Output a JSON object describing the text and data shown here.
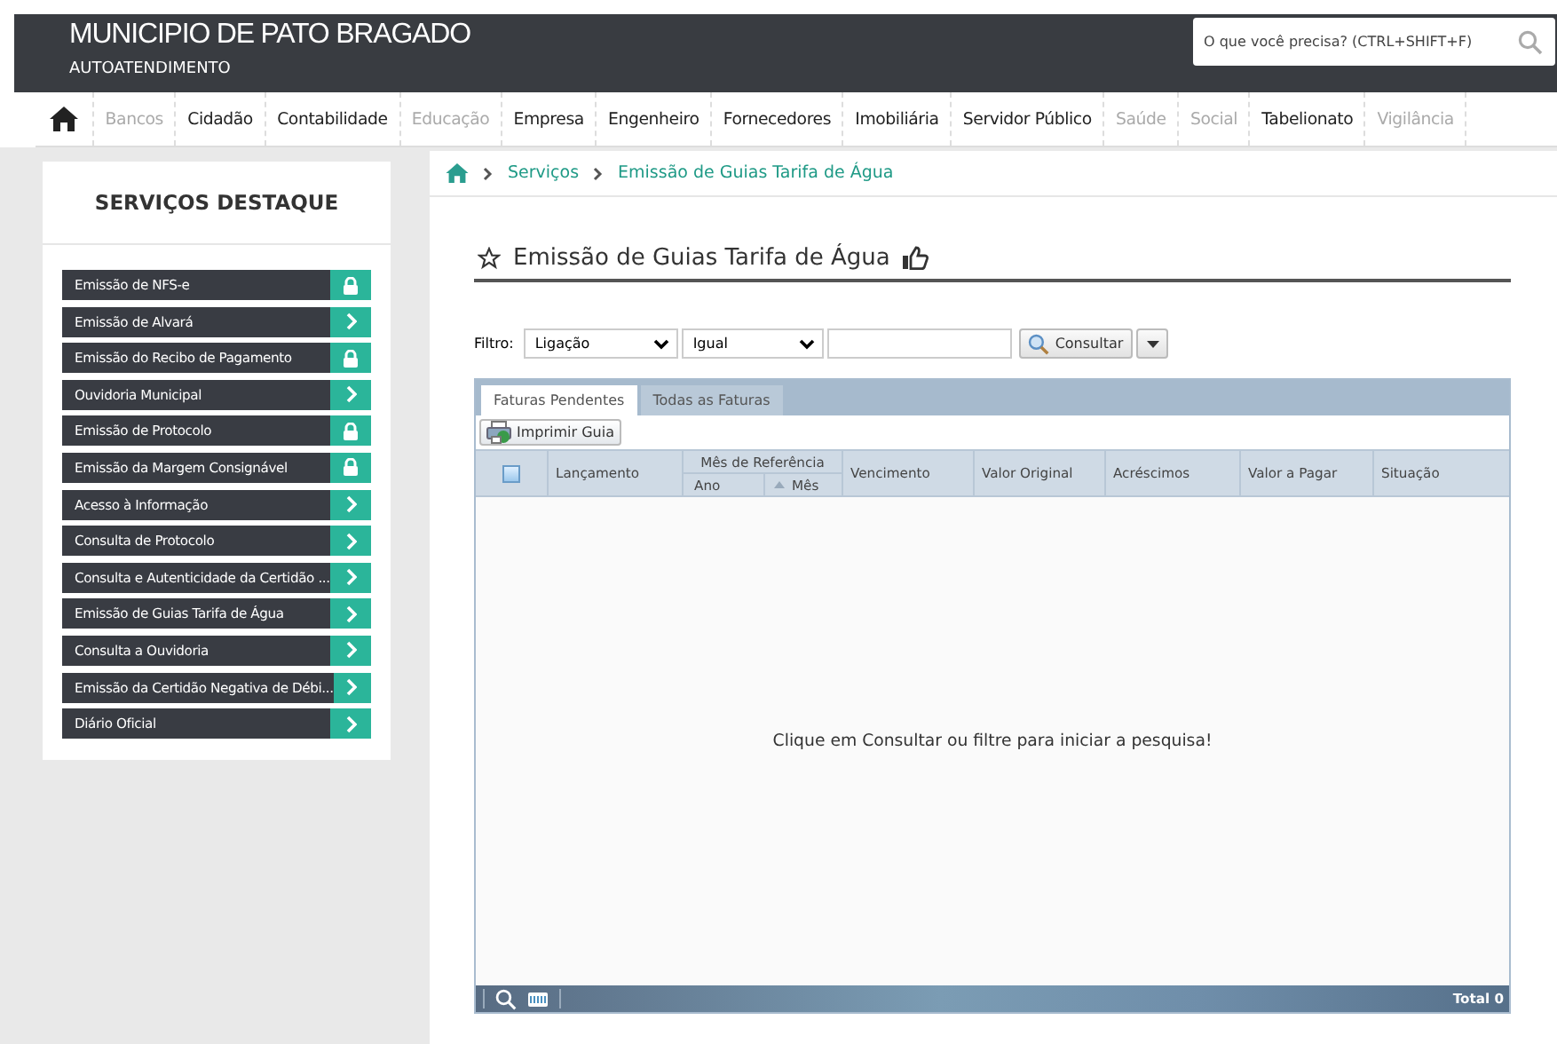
{
  "header": {
    "title": "MUNICIPIO DE PATO BRAGADO",
    "subtitle": "AUTOATENDIMENTO",
    "search": {
      "placeholder": "O que você precisa? (CTRL+SHIFT+F)"
    }
  },
  "nav": [
    {
      "label": "Bancos",
      "disabled": true
    },
    {
      "label": "Cidadão",
      "disabled": false
    },
    {
      "label": "Contabilidade",
      "disabled": false
    },
    {
      "label": "Educação",
      "disabled": true
    },
    {
      "label": "Empresa",
      "disabled": false
    },
    {
      "label": "Engenheiro",
      "disabled": false
    },
    {
      "label": "Fornecedores",
      "disabled": false
    },
    {
      "label": "Imobiliária",
      "disabled": false
    },
    {
      "label": "Servidor Público",
      "disabled": false
    },
    {
      "label": "Saúde",
      "disabled": true
    },
    {
      "label": "Social",
      "disabled": true
    },
    {
      "label": "Tabelionato",
      "disabled": false
    },
    {
      "label": "Vigilância",
      "disabled": true
    }
  ],
  "sidebar": {
    "title": "SERVIÇOS DESTAQUE",
    "items": [
      {
        "label": "Emissão de NFS-e",
        "kind": "lock"
      },
      {
        "label": "Emissão de Alvará",
        "kind": "arrow"
      },
      {
        "label": "Emissão do Recibo de Pagamento",
        "kind": "lock"
      },
      {
        "label": "Ouvidoria Municipal",
        "kind": "arrow"
      },
      {
        "label": "Emissão de Protocolo",
        "kind": "lock"
      },
      {
        "label": "Emissão da Margem Consignável",
        "kind": "lock"
      },
      {
        "label": "Acesso à Informação",
        "kind": "arrow"
      },
      {
        "label": "Consulta de Protocolo",
        "kind": "arrow"
      },
      {
        "label": "Consulta e Autenticidade da Certidão ...",
        "kind": "arrow"
      },
      {
        "label": "Emissão de Guias Tarifa de Água",
        "kind": "arrow"
      },
      {
        "label": "Consulta a Ouvidoria",
        "kind": "arrow"
      },
      {
        "label": "Emissão da Certidão Negativa de Débi...",
        "kind": "arrow"
      },
      {
        "label": "Diário Oficial",
        "kind": "arrow"
      }
    ]
  },
  "breadcrumb": [
    "Serviços",
    "Emissão de Guias Tarifa de Água"
  ],
  "page_title": "Emissão de Guias Tarifa de Água",
  "filter": {
    "label": "Filtro:",
    "field": "Ligação",
    "operator": "Igual",
    "button": "Consultar"
  },
  "tabs": [
    {
      "label": "Faturas Pendentes",
      "selected": true
    },
    {
      "label": "Todas as Faturas",
      "selected": false
    }
  ],
  "print_button": "Imprimir Guia",
  "columns": {
    "all_checked": false,
    "lancamento": "Lançamento",
    "group": "Mês de Referência",
    "ano": "Ano",
    "mes": "Mês",
    "rest": [
      "Vencimento",
      "Valor Original",
      "Acréscimos",
      "Valor a Pagar",
      "Situação"
    ]
  },
  "empty_message": "Clique em Consultar ou filtre para iniciar a pesquisa!",
  "footer": {
    "total": "Total 0"
  }
}
